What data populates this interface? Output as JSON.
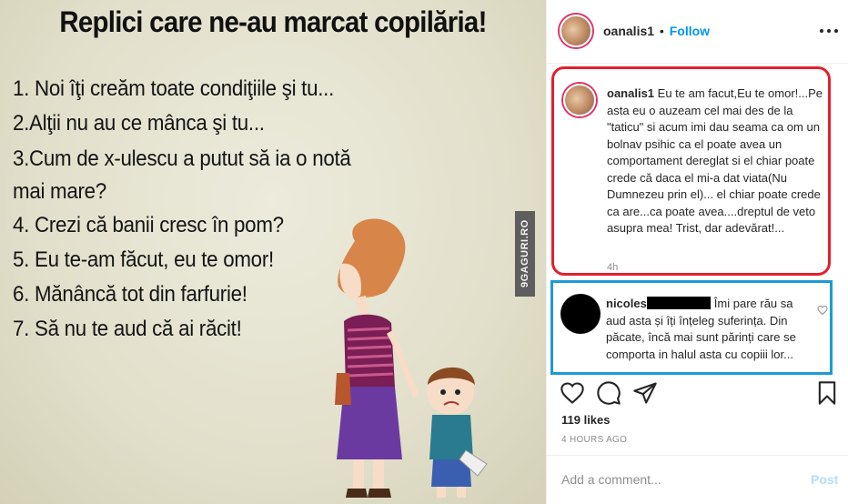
{
  "post_image": {
    "title": "Replici care ne-au marcat copilăria!",
    "lines": [
      "1. Noi îţi creăm toate condiţiile şi tu...",
      "2.Alţii nu au ce mânca şi tu...",
      "3.Cum de x-ulescu a putut să ia o notă",
      "mai mare?",
      "4. Crezi că banii cresc în pom?",
      "5. Eu te-am făcut, eu te omor!",
      "6. Mănâncă tot din farfurie!",
      "7. Să nu te aud că ai răcit!"
    ],
    "watermark": "9GAGURI.RO"
  },
  "header": {
    "username": "oanalis1",
    "separator": "•",
    "follow_label": "Follow"
  },
  "caption": {
    "username": "oanalis1",
    "text": "Eu te am facut,Eu te omor!...Pe asta eu o auzeam cel mai des de la \"taticu\" si acum imi dau seama ca om un bolnav psihic ca el poate avea un comportament dereglat si el chiar poate crede că daca el mi-a dat viata(Nu Dumnezeu prin el)... el chiar poate crede ca are...ca poate avea....dreptul de veto asupra mea! Trist, dar adevărat!...",
    "time": "4h"
  },
  "comment": {
    "username": "nicoles",
    "text": "Îmi pare rău sa aud asta și îți înțeleg suferința. Din păcate, încă mai sunt părinți care se comporta in halul asta cu copiii lor..."
  },
  "likes": "119 likes",
  "timestamp": "4 HOURS AGO",
  "add_comment": {
    "placeholder": "Add a comment...",
    "post_label": "Post"
  },
  "colors": {
    "follow": "#0095f6",
    "caption_highlight": "#e3202b",
    "comment_highlight": "#1c9ad6",
    "post_disabled": "#b2dffc"
  },
  "icons": [
    "more-options-icon",
    "like-icon",
    "comment-icon",
    "share-icon",
    "bookmark-icon",
    "comment-like-icon"
  ]
}
